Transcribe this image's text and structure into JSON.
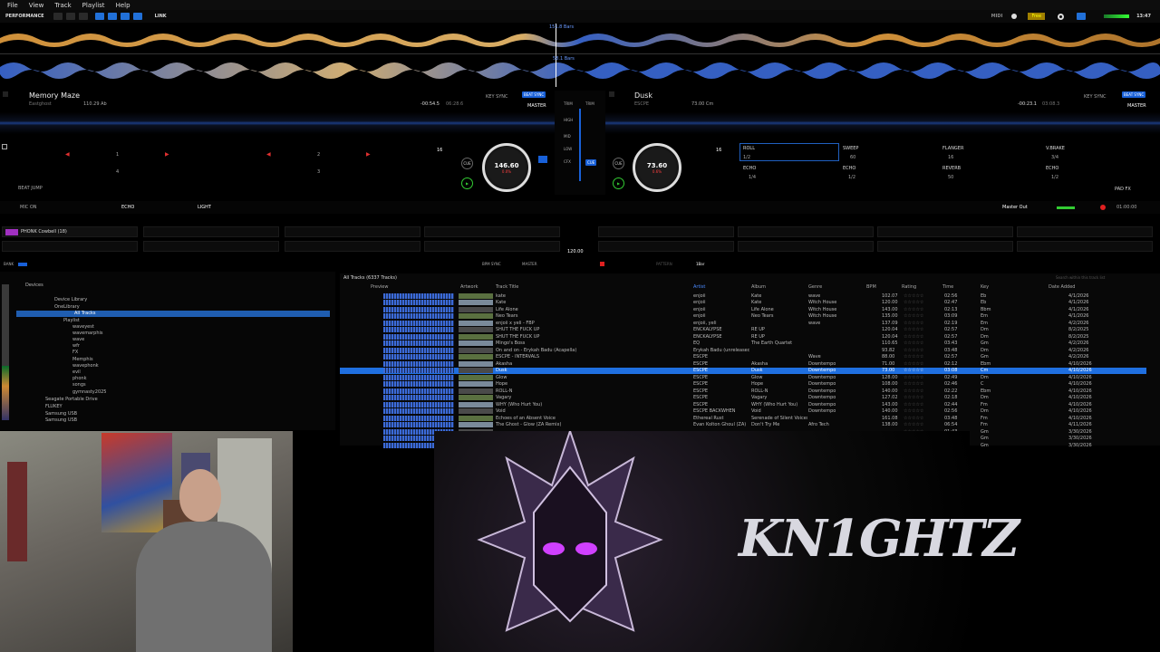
{
  "menu": {
    "file": "File",
    "view": "View",
    "track": "Track",
    "playlist": "Playlist",
    "help": "Help"
  },
  "toolbar": {
    "mode": "PERFORMANCE",
    "link": "LINK",
    "free": "Free",
    "midi": "MIDI",
    "time": "13:47"
  },
  "overview": {
    "bars_top": "151.8 Bars",
    "bars_bottom": "58.1 Bars"
  },
  "deck1": {
    "title": "Memory Maze",
    "artist": "Eastghost",
    "bpm_key": "110.29 Ab",
    "time": "-00:54.5",
    "total": "06:28.6",
    "key_sync": "KEY SYNC",
    "beat_sync": "BEAT SYNC",
    "master": "MASTER",
    "jog_bpm": "146.60",
    "jog_pct": "0.0%",
    "loop": "16",
    "cue": "CUE",
    "beat_jump": "BEAT JUMP",
    "pads": [
      "1",
      "2",
      "3",
      "4"
    ]
  },
  "deck2": {
    "title": "Dusk",
    "artist": "ESCPE",
    "bpm_key": "73.00 Cm",
    "time": "-00:23.1",
    "total": "03:08.3",
    "key_sync": "KEY SYNC",
    "beat_sync": "BEAT SYNC",
    "master": "MASTER",
    "jog_bpm": "73.60",
    "jog_pct": "0.6%",
    "loop": "16",
    "cue": "CUE"
  },
  "mixer": {
    "trim": "TRIM",
    "high": "HIGH",
    "mid": "MID",
    "low": "LOW",
    "cfx": "CFX",
    "cue": "CUE"
  },
  "fx": {
    "roll": "ROLL",
    "sweep": "SWEEP",
    "flanger": "FLANGER",
    "vbrake": "V.BRAKE",
    "echo": "ECHO",
    "reverb": "REVERB",
    "roll_v": "1/2",
    "sweep_v": "60",
    "flanger_v": "16",
    "vbrake_v": "3/4",
    "echo_v": "1/4",
    "echo2_v": "1/2",
    "reverb_v": "50",
    "echo3_v": "1/2",
    "padfx": "PAD FX"
  },
  "fxbar": {
    "mic": "MIC ON",
    "echo": "ECHO",
    "light": "LIGHT",
    "master_out": "Master Out",
    "rec": "01:00:00"
  },
  "sampler": {
    "slot1": "PHONK Cowbell (18)",
    "bpm": "120.00",
    "bank": "BANK",
    "bpm_sync": "BPM SYNC",
    "master": "MASTER",
    "pattern": "PATTERN",
    "bar": "1Bar"
  },
  "browser": {
    "header": "All Tracks (6337 Tracks)",
    "search": "Search within this track list",
    "cols": {
      "preview": "Preview",
      "artwork": "Artwork",
      "title": "Track Title",
      "artist": "Artist",
      "album": "Album",
      "genre": "Genre",
      "bpm": "BPM",
      "rating": "Rating",
      "time": "Time",
      "key": "Key",
      "date": "Date Added"
    }
  },
  "tree": {
    "devices": "Devices",
    "device_library": "Device Library",
    "onelibrary": "OneLibrary",
    "all_tracks": "All Tracks",
    "playlists": "Playlist",
    "items": [
      "waveyest",
      "wavemarphis",
      "wave",
      "wfr",
      "FX",
      "Memphis",
      "wavephonk",
      "evil",
      "phonk",
      "songs",
      "gymnasty2025"
    ],
    "seagate": "Seagate Portable Drive",
    "fluxy": "FLUKEY",
    "samsung1": "Samsung USB",
    "samsung2": "Samsung USB"
  },
  "tracks": [
    {
      "title": "kate",
      "artist": "enjoii",
      "album": "Kate",
      "genre": "wave",
      "bpm": "102.07",
      "time": "02:56",
      "key": "Eb",
      "date": "4/1/2026"
    },
    {
      "title": "Kate",
      "artist": "enjoii",
      "album": "Kate",
      "genre": "Witch House",
      "bpm": "120.00",
      "time": "02:47",
      "key": "Eb",
      "date": "4/1/2026"
    },
    {
      "title": "Life Alone",
      "artist": "enjoii",
      "album": "Life Alone",
      "genre": "Witch House",
      "bpm": "143.00",
      "time": "02:13",
      "key": "Bbm",
      "date": "4/1/2026"
    },
    {
      "title": "Neo Tears",
      "artist": "enjoii",
      "album": "Neo Tears",
      "genre": "Witch House",
      "bpm": "135.00",
      "time": "03:09",
      "key": "Em",
      "date": "4/1/2026"
    },
    {
      "title": "enjoii x yeli - FBP",
      "artist": "enjoii, yeli",
      "album": "",
      "genre": "wave",
      "bpm": "137.09",
      "time": "02:19",
      "key": "Em",
      "date": "4/2/2026"
    },
    {
      "title": "SHUT THE FUCK UP",
      "artist": "ENCKALYPSE",
      "album": "RE UP",
      "genre": "",
      "bpm": "120.04",
      "time": "02:57",
      "key": "Dm",
      "date": "8/2/2025"
    },
    {
      "title": "SHUT THE FUCK UP",
      "artist": "ENCKALYPSE",
      "album": "RE UP",
      "genre": "",
      "bpm": "120.04",
      "time": "02:57",
      "key": "Dm",
      "date": "8/2/2025"
    },
    {
      "title": "Mingo's Boss",
      "artist": "EQ",
      "album": "The Earth Quartet",
      "genre": "",
      "bpm": "110.65",
      "time": "03:43",
      "key": "Gm",
      "date": "4/2/2026"
    },
    {
      "title": "On and on - Erykah Badu (Acapella)",
      "artist": "Erykah Badu (unreleased)",
      "album": "",
      "genre": "",
      "bpm": "93.82",
      "time": "03:48",
      "key": "Dm",
      "date": "4/2/2026"
    },
    {
      "title": "ESCPE - INTERVALS",
      "artist": "ESCPE",
      "album": "",
      "genre": "Wave",
      "bpm": "88.00",
      "time": "02:57",
      "key": "Gm",
      "date": "4/2/2026"
    },
    {
      "title": "Akasha",
      "artist": "ESCPE",
      "album": "Akasha",
      "genre": "Downtempo",
      "bpm": "71.00",
      "time": "02:12",
      "key": "Ebm",
      "date": "4/10/2026"
    },
    {
      "title": "Dusk",
      "artist": "ESCPE",
      "album": "Dusk",
      "genre": "Downtempo",
      "bpm": "73.00",
      "time": "03:08",
      "key": "Cm",
      "date": "4/10/2026"
    },
    {
      "title": "Glow",
      "artist": "ESCPE",
      "album": "Glow",
      "genre": "Downtempo",
      "bpm": "128.00",
      "time": "02:49",
      "key": "Dm",
      "date": "4/10/2026"
    },
    {
      "title": "Hope",
      "artist": "ESCPE",
      "album": "Hope",
      "genre": "Downtempo",
      "bpm": "108.00",
      "time": "02:46",
      "key": "C",
      "date": "4/10/2026"
    },
    {
      "title": "ROLL-N",
      "artist": "ESCPE",
      "album": "ROLL-N",
      "genre": "Downtempo",
      "bpm": "140.00",
      "time": "02:22",
      "key": "Ebm",
      "date": "4/10/2026"
    },
    {
      "title": "Vagary",
      "artist": "ESCPE",
      "album": "Vagary",
      "genre": "Downtempo",
      "bpm": "127.02",
      "time": "02:18",
      "key": "Dm",
      "date": "4/10/2026"
    },
    {
      "title": "WHY (Who Hurt You)",
      "artist": "ESCPE",
      "album": "WHY (Who Hurt You)",
      "genre": "Downtempo",
      "bpm": "143.00",
      "time": "02:44",
      "key": "Fm",
      "date": "4/10/2026"
    },
    {
      "title": "Void",
      "artist": "ESCPE BACKWHEN",
      "album": "Void",
      "genre": "Downtempo",
      "bpm": "140.00",
      "time": "02:56",
      "key": "Dm",
      "date": "4/10/2026"
    },
    {
      "title": "Echoes of an Absent Voice",
      "artist": "Ethereal Rust",
      "album": "Serenade of Silent Voices",
      "genre": "",
      "bpm": "161.08",
      "time": "03:48",
      "key": "Fm",
      "date": "4/10/2026"
    },
    {
      "title": "The Ghost - Glow (ZA Remix)",
      "artist": "Evan Kolton Ghoul (ZA)",
      "album": "Don't Try Me",
      "genre": "Afro Tech",
      "bpm": "138.00",
      "time": "06:54",
      "key": "Fm",
      "date": "4/11/2026"
    },
    {
      "title": "",
      "artist": "",
      "album": "",
      "genre": "",
      "bpm": "",
      "time": "01:43",
      "key": "Gm",
      "date": "3/30/2026"
    },
    {
      "title": "",
      "artist": "",
      "album": "",
      "genre": "",
      "bpm": "",
      "time": "01:29",
      "key": "Gm",
      "date": "3/30/2026"
    },
    {
      "title": "",
      "artist": "",
      "album": "",
      "genre": "",
      "bpm": "",
      "time": "01:21",
      "key": "Gm",
      "date": "3/30/2026"
    }
  ],
  "brand": {
    "name": "KN1GHTZ"
  }
}
